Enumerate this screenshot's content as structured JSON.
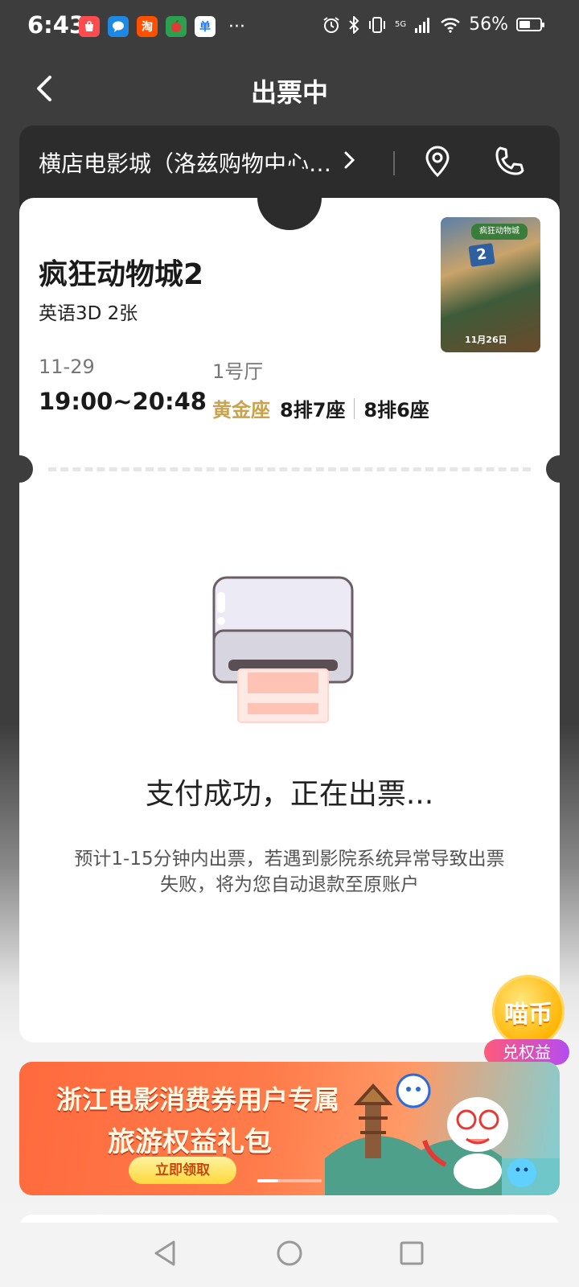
{
  "status_bar": {
    "time": "6:43",
    "app_icons": [
      "shopping-bag-icon",
      "message-icon",
      "taobao-icon",
      "tmall-icon",
      "alipay-icon"
    ],
    "taobao_glyph": "淘",
    "alipay_glyph": "单",
    "more": "···",
    "network": "5G",
    "battery": "56%",
    "battery_level": 0.56
  },
  "nav": {
    "title": "出票中"
  },
  "cinema": {
    "name": "横店电影城（洛兹购物中心店）"
  },
  "movie": {
    "title": "疯狂动物城2",
    "meta": "英语3D 2张",
    "date": "11-29",
    "showtime": "19:00~20:48",
    "hall": "1号厅",
    "seat_type": "黄金座",
    "seats": [
      "8排7座",
      "8排6座"
    ],
    "poster_logo": "疯狂动物城",
    "poster_number": "2",
    "poster_date": "11月26日"
  },
  "status": {
    "main": "支付成功，正在出票...",
    "sub": "预计1-15分钟内出票，若遇到影院系统异常导致出票失败，将为您自动退款至原账户"
  },
  "coin_badge": {
    "text": "喵币",
    "label": "兑权益"
  },
  "banner": {
    "line1": "浙江电影消费券用户专属",
    "line2": "旅游权益礼包",
    "button": "立即领取"
  },
  "colors": {
    "header_bg": "#3d3d3d",
    "card_bg": "#ffffff",
    "gold": "#c9a24c",
    "banner_orange": "#ff6a3d"
  }
}
